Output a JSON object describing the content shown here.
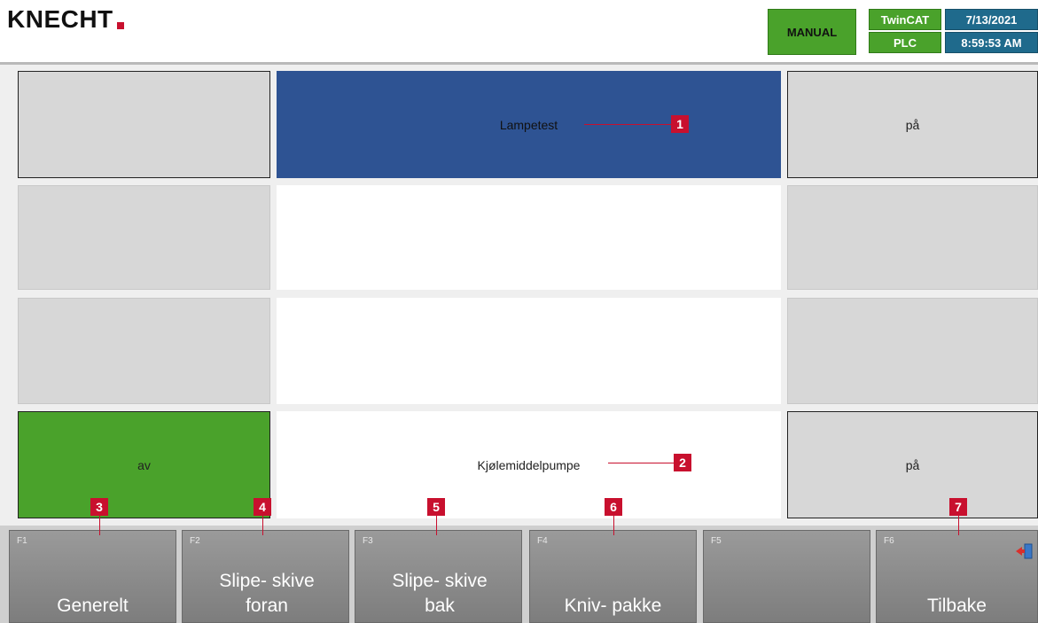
{
  "header": {
    "logo": "KNECHT",
    "mode": "MANUAL",
    "twincat": "TwinCAT",
    "plc": "PLC",
    "date": "7/13/2021",
    "time": "8:59:53 AM"
  },
  "rows": [
    {
      "left": "",
      "label": "Lampetest",
      "right": "på"
    },
    {
      "left": "",
      "label": "",
      "right": ""
    },
    {
      "left": "",
      "label": "",
      "right": ""
    },
    {
      "left": "av",
      "label": "Kjølemiddelpumpe",
      "right": "på"
    }
  ],
  "callouts": [
    "1",
    "2",
    "3",
    "4",
    "5",
    "6",
    "7"
  ],
  "function_keys": [
    {
      "key": "F1",
      "label": "Generelt"
    },
    {
      "key": "F2",
      "label": "Slipe- skive foran"
    },
    {
      "key": "F3",
      "label": "Slipe- skive bak"
    },
    {
      "key": "F4",
      "label": "Kniv- pakke"
    },
    {
      "key": "F5",
      "label": ""
    },
    {
      "key": "F6",
      "label": "Tilbake"
    }
  ],
  "colors": {
    "accent_red": "#c8102e",
    "status_green": "#4aa22b",
    "active_blue": "#2e5393",
    "info_blue": "#1f6a8c"
  },
  "icons": {
    "exit": "exit-door-icon"
  }
}
